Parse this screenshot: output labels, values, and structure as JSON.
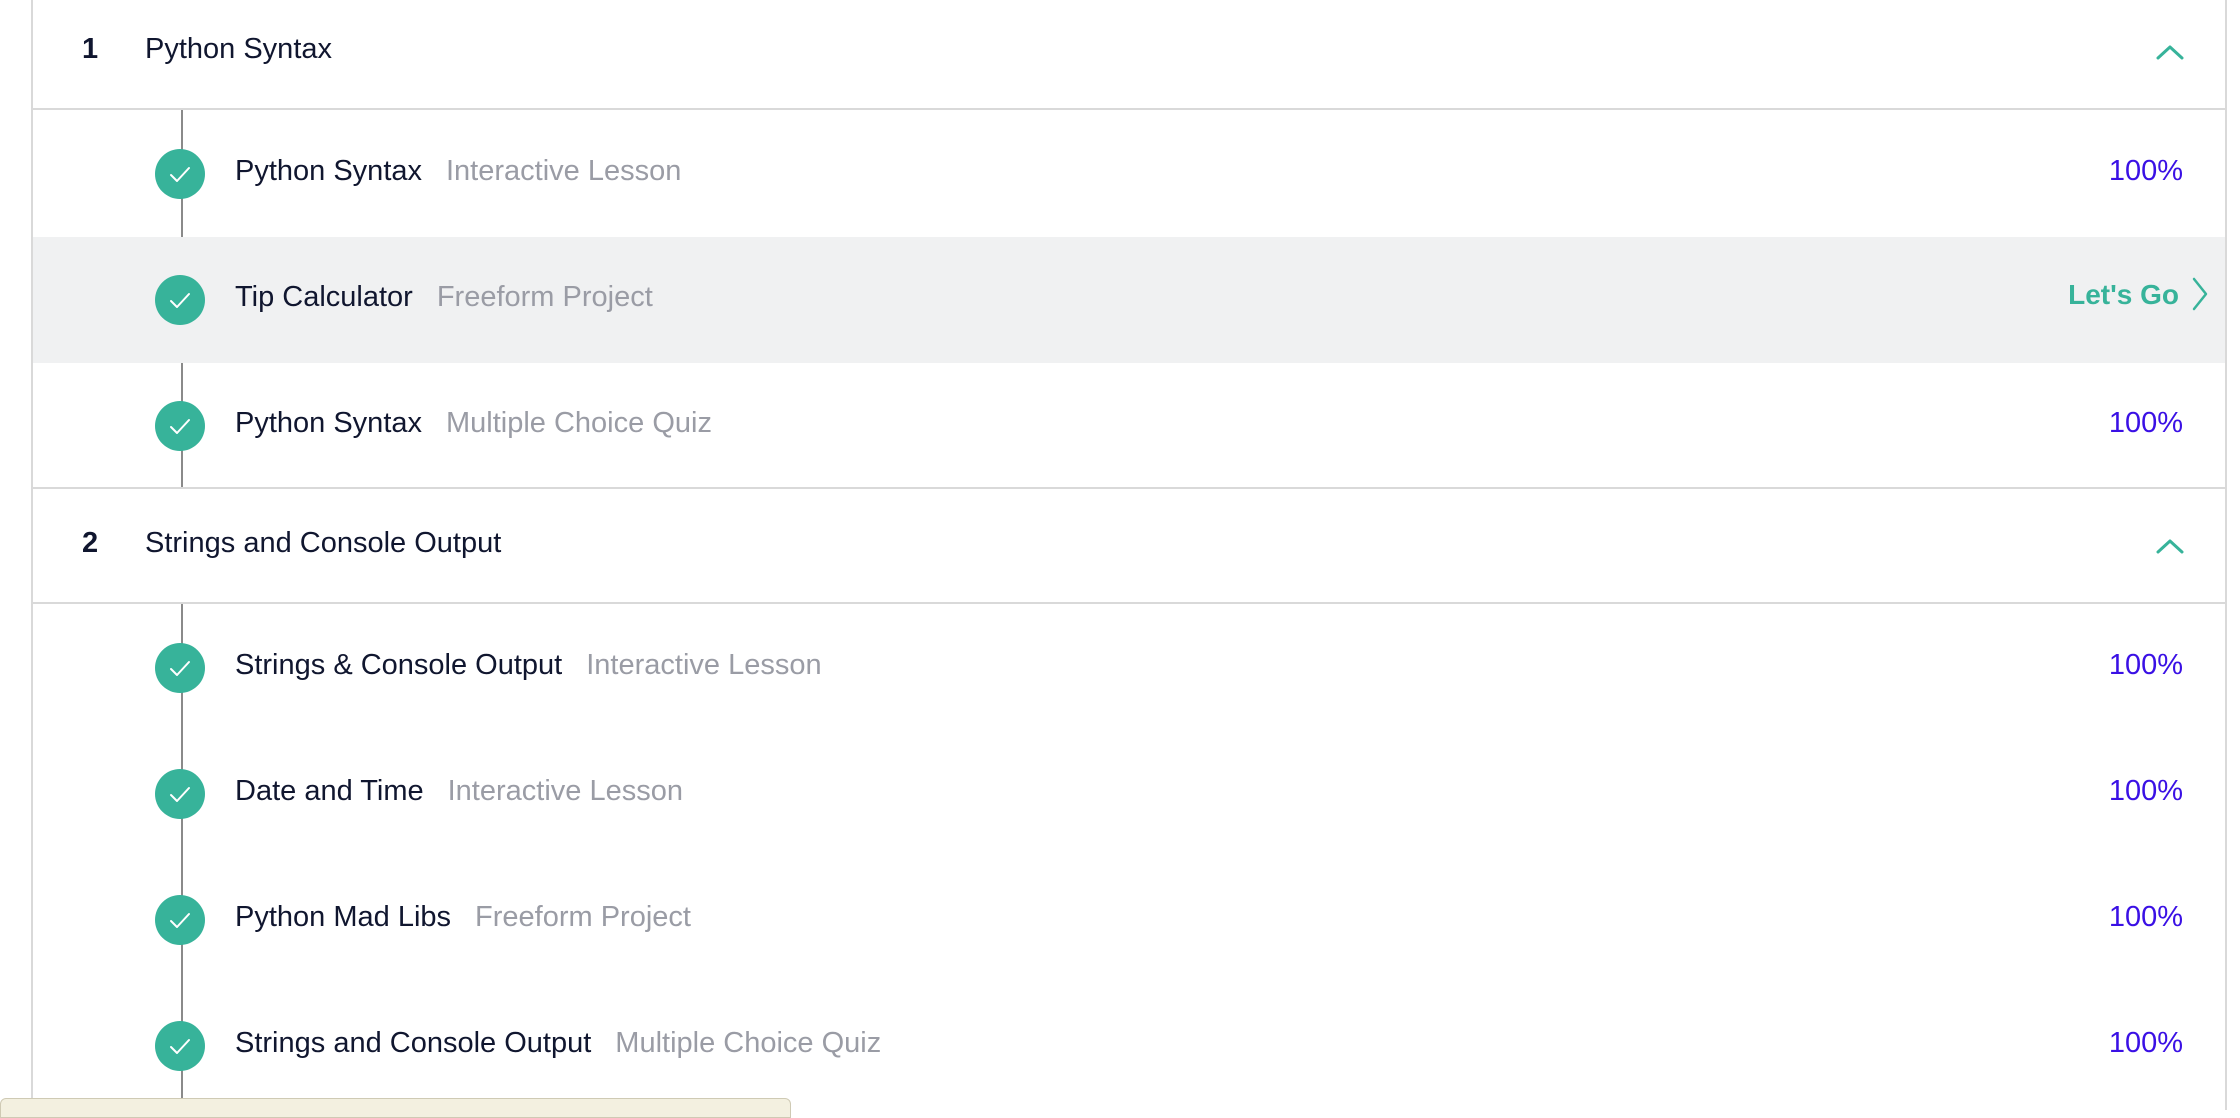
{
  "colors": {
    "accent": "#37b39a",
    "progress": "#3a10e5",
    "muted_text": "#9a9ca5",
    "primary_text": "#10162f",
    "highlight_row": "#f0f1f2"
  },
  "modules": [
    {
      "number": "1",
      "title": "Python Syntax",
      "collapse_icon": "chevron-up-icon",
      "items": [
        {
          "title": "Python Syntax",
          "type": "Interactive Lesson",
          "progress": "100%",
          "status_icon": "check-circle-icon"
        },
        {
          "title": "Tip Calculator",
          "type": "Freeform Project",
          "action": "Let's Go",
          "action_icon": "chevron-right-icon",
          "status_icon": "check-circle-icon"
        },
        {
          "title": "Python Syntax",
          "type": "Multiple Choice Quiz",
          "progress": "100%",
          "status_icon": "check-circle-icon"
        }
      ]
    },
    {
      "number": "2",
      "title": "Strings and Console Output",
      "collapse_icon": "chevron-up-icon",
      "items": [
        {
          "title": "Strings & Console Output",
          "type": "Interactive Lesson",
          "progress": "100%",
          "status_icon": "check-circle-icon"
        },
        {
          "title": "Date and Time",
          "type": "Interactive Lesson",
          "progress": "100%",
          "status_icon": "check-circle-icon"
        },
        {
          "title": "Python Mad Libs",
          "type": "Freeform Project",
          "progress": "100%",
          "status_icon": "check-circle-icon"
        },
        {
          "title": "Strings and Console Output",
          "type": "Multiple Choice Quiz",
          "progress": "100%",
          "status_icon": "check-circle-icon"
        }
      ]
    }
  ]
}
